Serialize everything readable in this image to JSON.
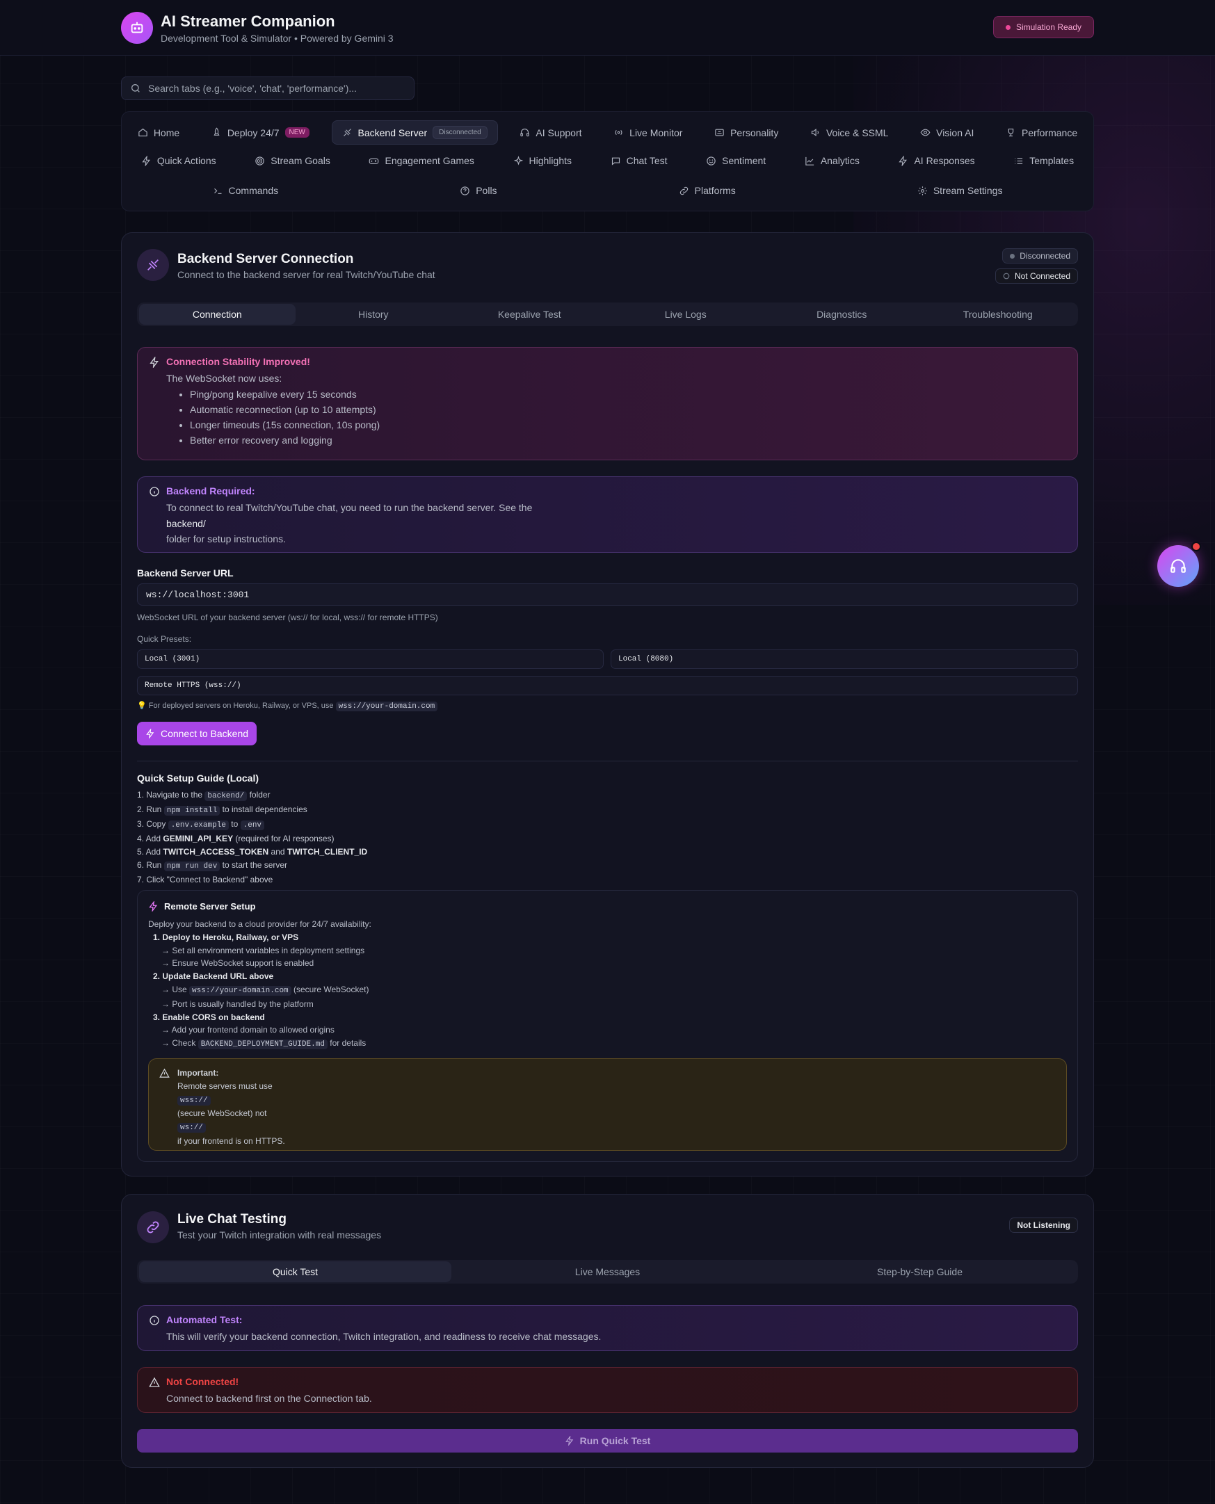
{
  "header": {
    "title": "AI Streamer Companion",
    "subtitle": "Development Tool & Simulator • Powered by Gemini 3",
    "status_badge": "Simulation Ready"
  },
  "search": {
    "placeholder": "Search tabs (e.g., 'voice', 'chat', 'performance')..."
  },
  "nav": {
    "row1": [
      {
        "label": "Home",
        "icon": "home-icon"
      },
      {
        "label": "Deploy 24/7",
        "icon": "rocket-icon",
        "badge": "NEW"
      },
      {
        "label": "Backend Server",
        "icon": "plug-icon",
        "badge": "Disconnected",
        "active": true
      },
      {
        "label": "AI Support",
        "icon": "headphones-icon"
      },
      {
        "label": "Live Monitor",
        "icon": "radio-icon"
      },
      {
        "label": "Personality",
        "icon": "id-card-icon"
      },
      {
        "label": "Voice & SSML",
        "icon": "speaker-icon"
      },
      {
        "label": "Vision AI",
        "icon": "eye-icon"
      },
      {
        "label": "Performance",
        "icon": "trophy-icon"
      }
    ],
    "row2": [
      {
        "label": "Quick Actions",
        "icon": "bolt-icon"
      },
      {
        "label": "Stream Goals",
        "icon": "target-icon"
      },
      {
        "label": "Engagement Games",
        "icon": "gamepad-icon"
      },
      {
        "label": "Highlights",
        "icon": "sparkles-icon"
      },
      {
        "label": "Chat Test",
        "icon": "chat-bubble-icon"
      },
      {
        "label": "Sentiment",
        "icon": "smile-icon"
      },
      {
        "label": "Analytics",
        "icon": "chart-line-icon"
      },
      {
        "label": "AI Responses",
        "icon": "bolt-icon"
      },
      {
        "label": "Templates",
        "icon": "list-icon"
      }
    ],
    "row3": [
      {
        "label": "Commands",
        "icon": "terminal-icon"
      },
      {
        "label": "Polls",
        "icon": "help-circle-icon"
      },
      {
        "label": "Platforms",
        "icon": "link-icon"
      },
      {
        "label": "Stream Settings",
        "icon": "gear-icon"
      }
    ]
  },
  "backend_card": {
    "title": "Backend Server Connection",
    "subtitle": "Connect to the backend server for real Twitch/YouTube chat",
    "status_1": "Disconnected",
    "status_2": "Not Connected",
    "tabs": [
      "Connection",
      "History",
      "Keepalive Test",
      "Live Logs",
      "Diagnostics",
      "Troubleshooting"
    ],
    "stability": {
      "title": "Connection Stability Improved!",
      "intro": "The WebSocket now uses:",
      "items": [
        "Ping/pong keepalive every 15 seconds",
        "Automatic reconnection (up to 10 attempts)",
        "Longer timeouts (15s connection, 10s pong)",
        "Better error recovery and logging"
      ]
    },
    "required": {
      "title": "Backend Required:",
      "line1": "To connect to real Twitch/YouTube chat, you need to run the backend server. See the",
      "folder": "backend/",
      "line3": "folder for setup instructions."
    },
    "url_label": "Backend Server URL",
    "url_value": "ws://localhost:3001",
    "url_hint": "WebSocket URL of your backend server (ws:// for local, wss:// for remote HTTPS)",
    "presets_label": "Quick Presets:",
    "presets": [
      "Local (3001)",
      "Local (8080)",
      "Remote HTTPS (wss://)"
    ],
    "deploy_hint": "For deployed servers on Heroku, Railway, or VPS, use",
    "deploy_hint_code": "wss://your-domain.com",
    "connect_button": "Connect to Backend",
    "guide": {
      "title": "Quick Setup Guide (Local)",
      "s1a": "1. Navigate to the",
      "s1code": "backend/",
      "s1b": "folder",
      "s2a": "2. Run",
      "s2code": "npm install",
      "s2b": "to install dependencies",
      "s3a": "3. Copy",
      "s3code1": ".env.example",
      "s3b": "to",
      "s3code2": ".env",
      "s4a": "4. Add",
      "s4bold": "GEMINI_API_KEY",
      "s4b": "(required for AI responses)",
      "s5a": "5. Add",
      "s5bold1": "TWITCH_ACCESS_TOKEN",
      "s5b": "and",
      "s5bold2": "TWITCH_CLIENT_ID",
      "s6a": "6. Run",
      "s6code": "npm run dev",
      "s6b": "to start the server",
      "s7": "7. Click \"Connect to Backend\" above"
    },
    "remote": {
      "title": "Remote Server Setup",
      "intro": "Deploy your backend to a cloud provider for 24/7 availability:",
      "h1": "1. Deploy to Heroku, Railway, or VPS",
      "h1a": "→ Set all environment variables in deployment settings",
      "h1b": "→ Ensure WebSocket support is enabled",
      "h2": "2. Update Backend URL above",
      "h2a_pre": "→ Use",
      "h2a_code": "wss://your-domain.com",
      "h2a_post": "(secure WebSocket)",
      "h2b": "→ Port is usually handled by the platform",
      "h3": "3. Enable CORS on backend",
      "h3a": "→ Add your frontend domain to allowed origins",
      "h3b_pre": "→ Check",
      "h3b_code": "BACKEND_DEPLOYMENT_GUIDE.md",
      "h3b_post": "for details"
    },
    "important": {
      "title": "Important:",
      "line1": "Remote servers must use",
      "code1": "wss://",
      "line2": "(secure WebSocket) not",
      "code2": "ws://",
      "line3": "if your frontend is on HTTPS."
    }
  },
  "chat_card": {
    "title": "Live Chat Testing",
    "subtitle": "Test your Twitch integration with real messages",
    "status": "Not Listening",
    "tabs": [
      "Quick Test",
      "Live Messages",
      "Step-by-Step Guide"
    ],
    "auto_title": "Automated Test:",
    "auto_text": "This will verify your backend connection, Twitch integration, and readiness to receive chat messages.",
    "error_title": "Not Connected!",
    "error_text": "Connect to backend first on the Connection tab.",
    "run_button": "Run Quick Test"
  },
  "colors": {
    "accent": "#a946e8",
    "pink": "#ec4899",
    "background": "#0b0c16",
    "error": "#ef4444"
  }
}
